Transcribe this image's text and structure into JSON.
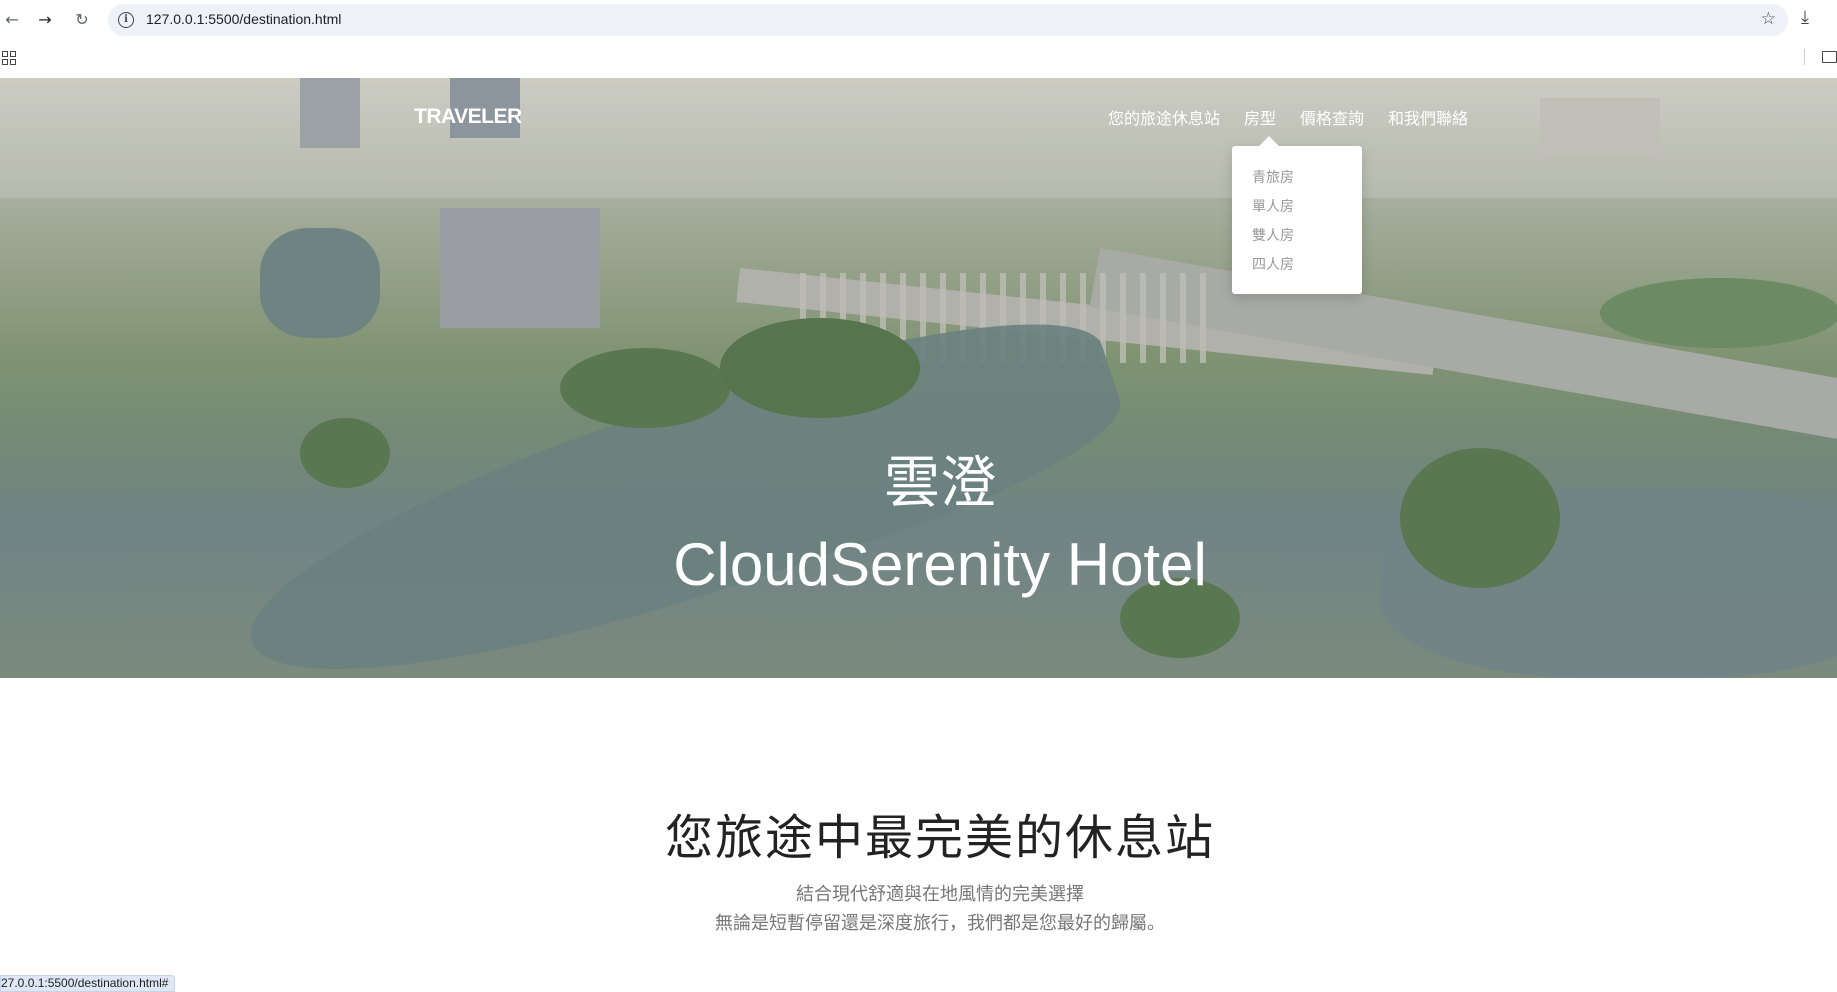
{
  "browser": {
    "url": "127.0.0.1:5500/destination.html",
    "status_url": "27.0.0.1:5500/destination.html#",
    "icons": [
      "back-icon",
      "forward-icon",
      "reload-icon",
      "site-info-icon",
      "bookmark-star-icon",
      "download-icon",
      "apps-icon",
      "folder-icon"
    ]
  },
  "nav": {
    "brand": "TRAVELER",
    "items": [
      {
        "label": "您的旅途休息站"
      },
      {
        "label": "房型"
      },
      {
        "label": "價格查詢"
      },
      {
        "label": "和我們聯絡"
      }
    ],
    "dropdown": [
      "青旅房",
      "單人房",
      "雙人房",
      "四人房"
    ]
  },
  "hero": {
    "title_zh": "雲澄",
    "title_en": "CloudSerenity Hotel"
  },
  "intro": {
    "title": "您旅途中最完美的休息站",
    "line1": "結合現代舒適與在地風情的完美選擇",
    "line2": "無論是短暫停留還是深度旅行，我們都是您最好的歸屬。"
  },
  "colors": {
    "nav_text": "#ffffff",
    "dropdown_text": "#999999",
    "heading": "#222222",
    "subtext": "#777777"
  }
}
